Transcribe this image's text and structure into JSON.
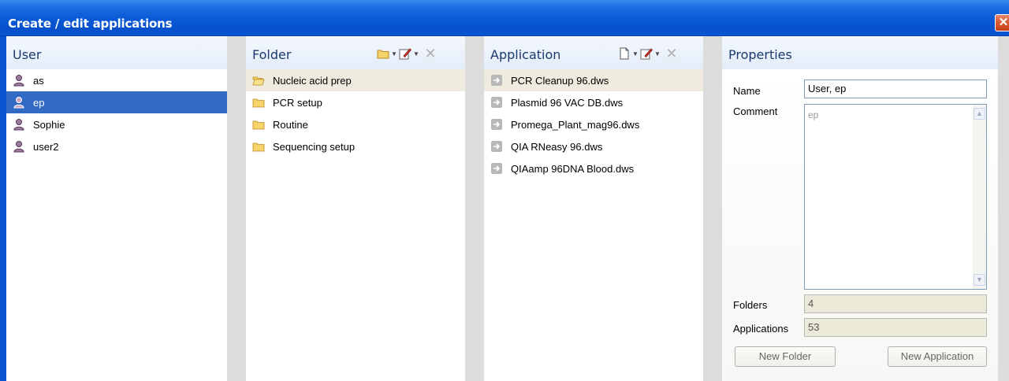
{
  "window": {
    "title": "Create / edit applications",
    "close_glyph": "✕"
  },
  "user_panel": {
    "title": "User",
    "items": [
      {
        "label": "as",
        "icon": "user-icon"
      },
      {
        "label": "ep",
        "icon": "user-icon"
      },
      {
        "label": "Sophie",
        "icon": "user-icon"
      },
      {
        "label": "user2",
        "icon": "user-icon"
      }
    ],
    "selected": "ep"
  },
  "folder_panel": {
    "title": "Folder",
    "toolbar": [
      "new-folder-icon",
      "edit-icon",
      "delete-icon"
    ],
    "items": [
      {
        "label": "Nucleic acid prep",
        "icon": "open-folder-icon"
      },
      {
        "label": "PCR setup",
        "icon": "folder-icon"
      },
      {
        "label": "Routine",
        "icon": "folder-icon"
      },
      {
        "label": "Sequencing setup",
        "icon": "folder-icon"
      }
    ],
    "selected": "Nucleic acid prep"
  },
  "application_panel": {
    "title": "Application",
    "toolbar": [
      "new-document-icon",
      "edit-icon",
      "delete-icon"
    ],
    "items": [
      {
        "label": "PCR Cleanup 96.dws",
        "icon": "application-file-icon"
      },
      {
        "label": "Plasmid 96 VAC DB.dws",
        "icon": "application-file-icon"
      },
      {
        "label": "Promega_Plant_mag96.dws",
        "icon": "application-file-icon"
      },
      {
        "label": "QIA RNeasy 96.dws",
        "icon": "application-file-icon"
      },
      {
        "label": "QIAamp 96DNA Blood.dws",
        "icon": "application-file-icon"
      }
    ],
    "selected": "PCR Cleanup 96.dws"
  },
  "properties_panel": {
    "title": "Properties",
    "name_label": "Name",
    "name_value": "User, ep",
    "comment_label": "Comment",
    "comment_value": "ep",
    "folders_label": "Folders",
    "folders_value": "4",
    "applications_label": "Applications",
    "applications_value": "53",
    "new_folder_button": "New Folder",
    "new_application_button": "New Application"
  },
  "colors": {
    "titlebar": "#0b5ad8",
    "selection_blue": "#316ac5",
    "selection_beige": "#f0ebdf",
    "panel_header": "#e3ecf8"
  }
}
